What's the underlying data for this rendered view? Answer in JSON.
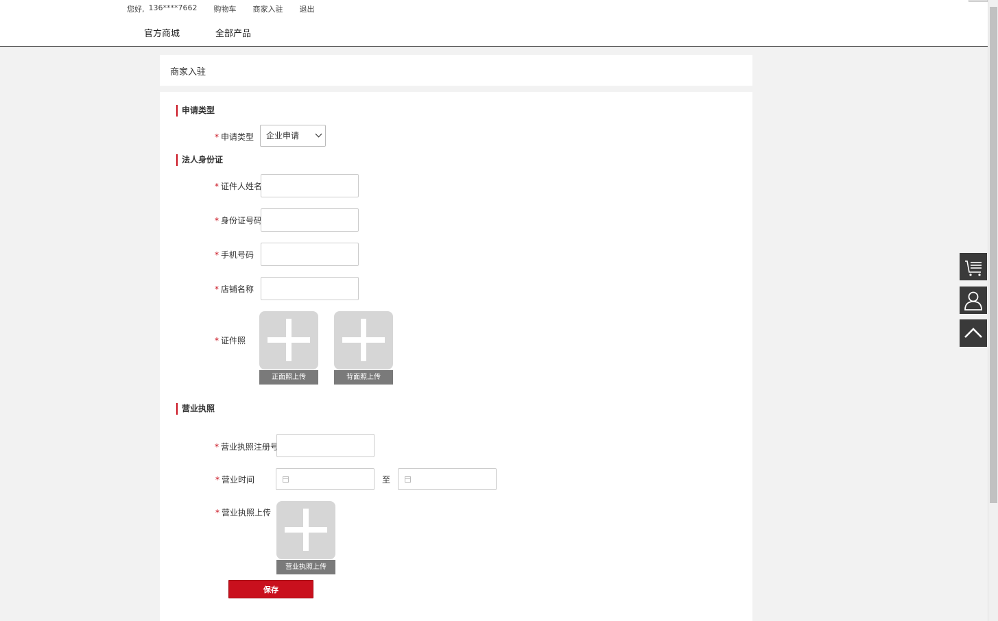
{
  "header": {
    "greeting": "您好,",
    "phone": "136****7662",
    "cart": "购物车",
    "merchant": "商家入驻",
    "logout": "退出",
    "nav": [
      "官方商城",
      "全部产品"
    ]
  },
  "page_title": "商家入驻",
  "sections": {
    "apply_type": "申请类型",
    "legal_id": "法人身份证",
    "license": "营业执照"
  },
  "fields": {
    "apply_type_label": "申请类型",
    "apply_type_value": "企业申请",
    "id_name_label": "证件人姓名",
    "id_number_label": "身份证号码",
    "phone_label": "手机号码",
    "shop_name_label": "店铺名称",
    "id_photo_label": "证件照",
    "front_upload": "正面照上传",
    "back_upload": "背面照上传",
    "license_no_label": "营业执照注册号",
    "business_time_label": "营业时间",
    "to": "至",
    "license_upload_label": "营业执照上传",
    "license_upload": "营业执照上传"
  },
  "required_mark": "*",
  "save_label": "保存",
  "colors": {
    "accent": "#c9101d",
    "sidebar": "#3a3a3a"
  },
  "side_icons": [
    "cart-list-icon",
    "user-icon",
    "back-to-top-icon"
  ]
}
